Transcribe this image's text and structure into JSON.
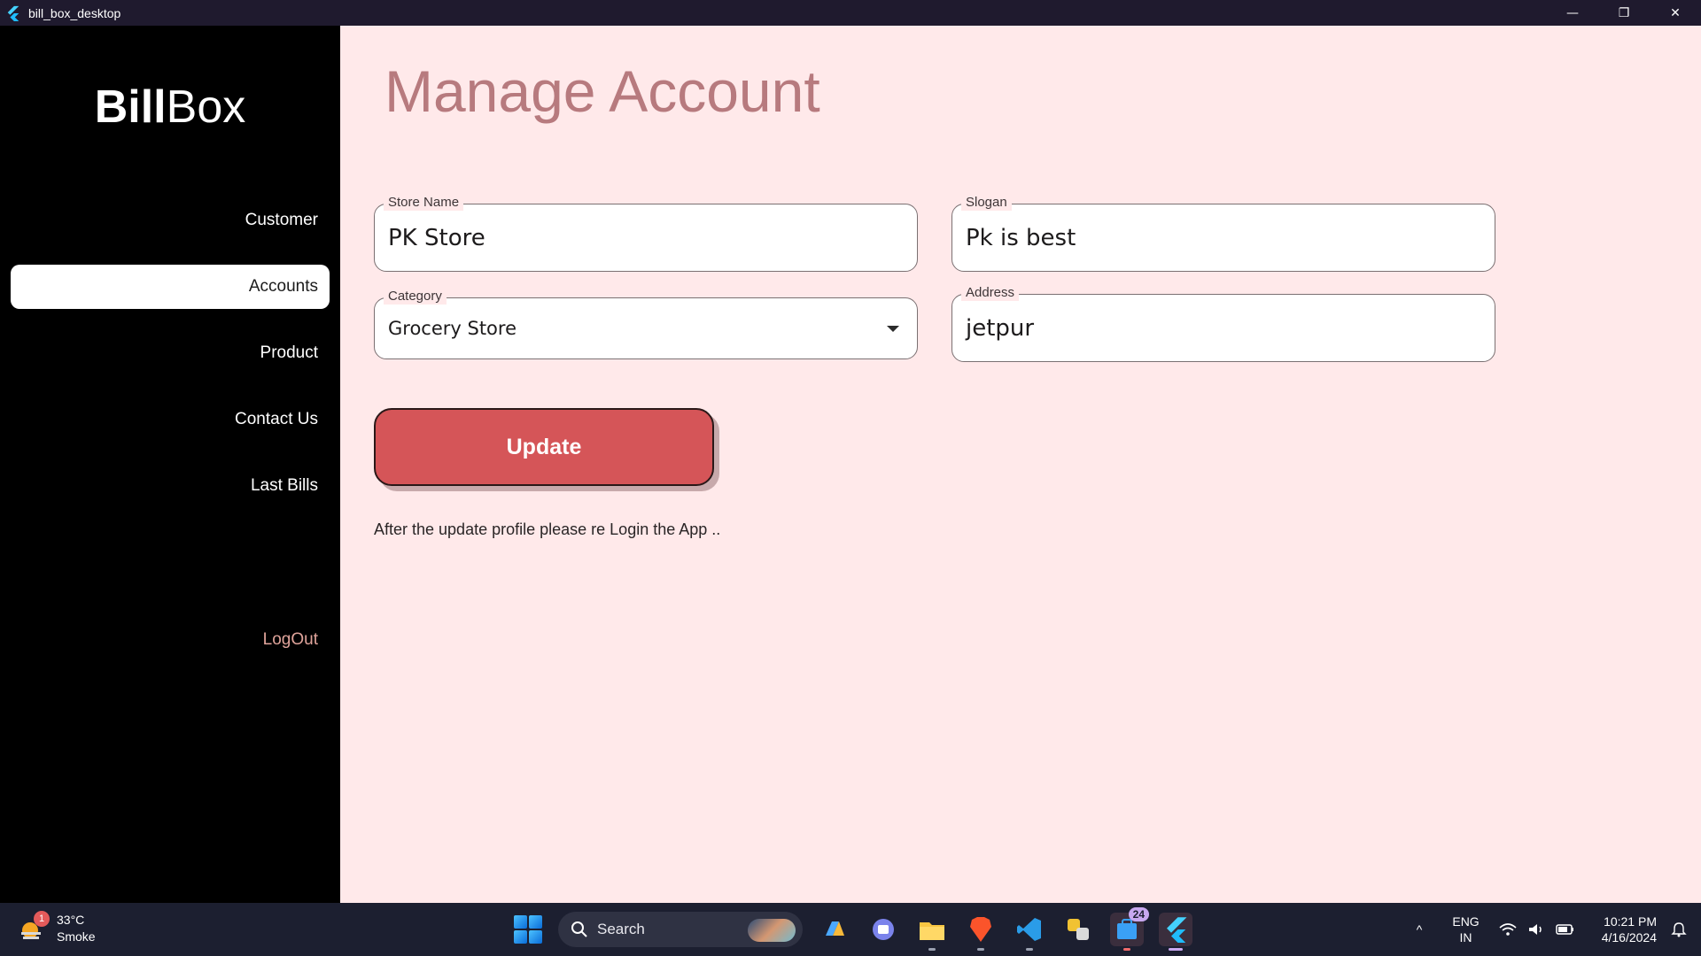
{
  "window": {
    "title": "bill_box_desktop",
    "controls": {
      "minimize": "—",
      "restore": "❐",
      "close": "✕"
    }
  },
  "sidebar": {
    "logo_bold": "Bill",
    "logo_light": "Box",
    "items": [
      {
        "label": "Customer",
        "active": false
      },
      {
        "label": "Accounts",
        "active": true
      },
      {
        "label": "Product",
        "active": false
      },
      {
        "label": "Contact Us",
        "active": false
      },
      {
        "label": "Last Bills",
        "active": false
      }
    ],
    "logout_label": "LogOut"
  },
  "main": {
    "title": "Manage Account",
    "form": {
      "store_name": {
        "label": "Store Name",
        "value": "PK Store"
      },
      "slogan": {
        "label": "Slogan",
        "value": "Pk is best"
      },
      "category": {
        "label": "Category",
        "value": "Grocery Store"
      },
      "address": {
        "label": "Address",
        "value": "jetpur"
      }
    },
    "update_label": "Update",
    "note": "After the update profile please re Login the App .."
  },
  "taskbar": {
    "weather": {
      "badge": "1",
      "temp": "33°C",
      "condition": "Smoke"
    },
    "search_label": "Search",
    "apps": [
      "copilot-icon",
      "teams-icon",
      "file-explorer-icon",
      "brave-icon",
      "vscode-icon",
      "python-icon",
      "store-icon",
      "flutter-icon"
    ],
    "store_badge": "24",
    "tray": {
      "chevron": "^",
      "lang_line1": "ENG",
      "lang_line2": "IN",
      "time": "10:21 PM",
      "date": "4/16/2024"
    }
  },
  "colors": {
    "sidebar_bg": "#000000",
    "main_bg": "#ffe9ea",
    "title_color": "#b77a7e",
    "accent": "#d55558",
    "logout": "#e0a49b"
  }
}
